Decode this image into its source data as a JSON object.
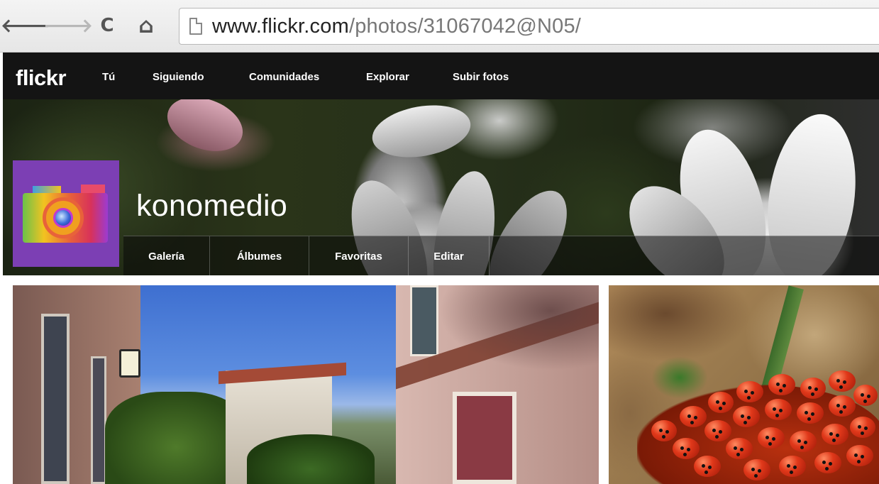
{
  "browser": {
    "url_host": "www.flickr.com",
    "url_path": "/photos/31067042@N05/",
    "back_glyph": "🡐",
    "forward_glyph": "🡒",
    "reload_glyph": "C",
    "home_glyph": "⌂"
  },
  "flickr_nav": {
    "logo": "flickr",
    "links": [
      "Tú",
      "Siguiendo",
      "Comunidades",
      "Explorar",
      "Subir fotos"
    ]
  },
  "profile": {
    "username": "konomedio",
    "avatar_icon": "camera-icon",
    "tabs": [
      "Galería",
      "Álbumes",
      "Favoritas",
      "Editar"
    ],
    "active_tab": "Galería"
  },
  "gallery": {
    "photos": [
      "street-photo",
      "ladybugs-photo"
    ]
  },
  "colors": {
    "nav_background": "#141414",
    "avatar_background": "#7c3fb4"
  }
}
